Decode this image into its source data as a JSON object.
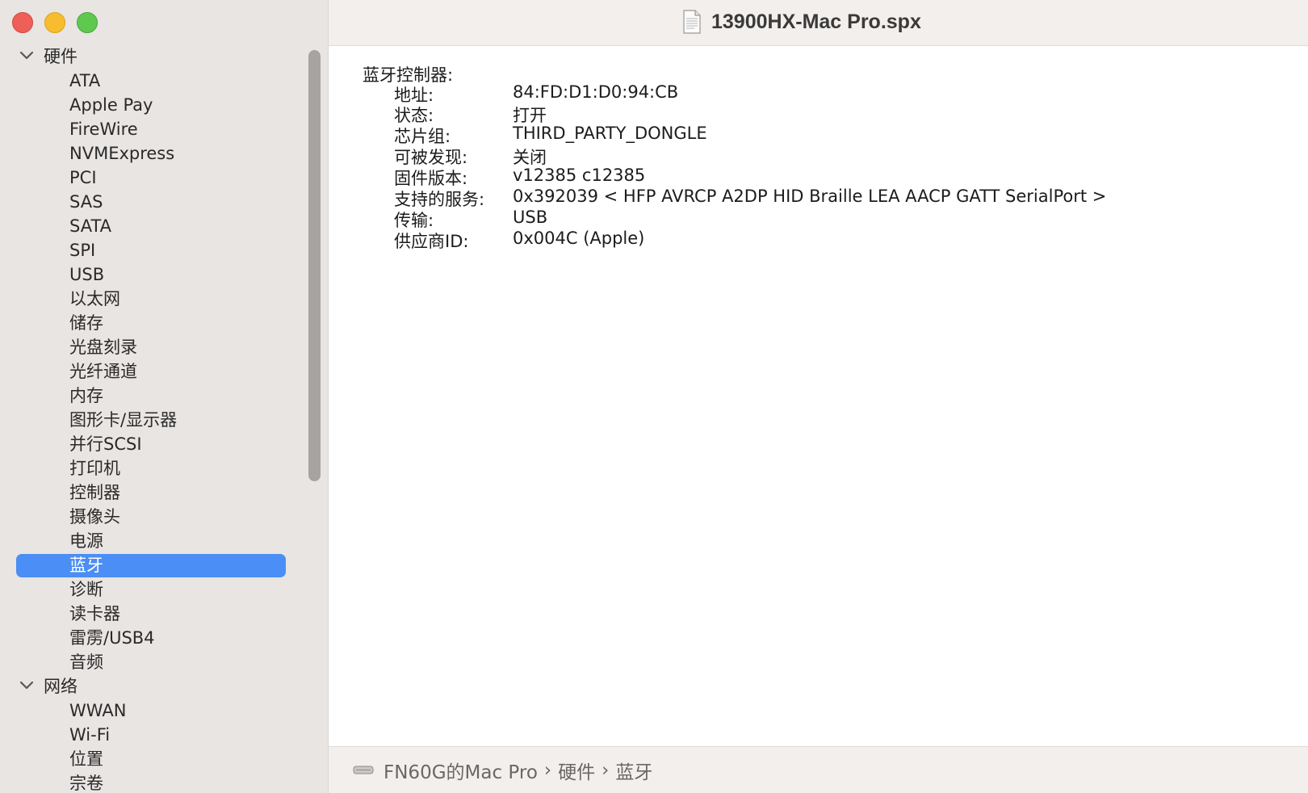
{
  "window": {
    "title": "13900HX-Mac Pro.spx",
    "title_icon": "document-icon"
  },
  "sidebar": {
    "groups": [
      {
        "label": "硬件",
        "expanded": true,
        "items": [
          "ATA",
          "Apple Pay",
          "FireWire",
          "NVMExpress",
          "PCI",
          "SAS",
          "SATA",
          "SPI",
          "USB",
          "以太网",
          "储存",
          "光盘刻录",
          "光纤通道",
          "内存",
          "图形卡/显示器",
          "并行SCSI",
          "打印机",
          "控制器",
          "摄像头",
          "电源",
          "蓝牙",
          "诊断",
          "读卡器",
          "雷雳/USB4",
          "音频"
        ]
      },
      {
        "label": "网络",
        "expanded": true,
        "items": [
          "WWAN",
          "Wi-Fi",
          "位置",
          "宗卷"
        ]
      }
    ],
    "selected": "蓝牙",
    "selection_color": "#4b8ef5"
  },
  "content": {
    "section_title": "蓝牙控制器:",
    "properties": [
      {
        "label": "地址:",
        "value": "84:FD:D1:D0:94:CB"
      },
      {
        "label": "状态:",
        "value": "打开"
      },
      {
        "label": "芯片组:",
        "value": "THIRD_PARTY_DONGLE"
      },
      {
        "label": "可被发现:",
        "value": "关闭"
      },
      {
        "label": "固件版本:",
        "value": "v12385 c12385"
      },
      {
        "label": "支持的服务:",
        "value": "0x392039 < HFP AVRCP A2DP HID Braille LEA AACP GATT SerialPort >"
      },
      {
        "label": "传输:",
        "value": "USB"
      },
      {
        "label": "供应商ID:",
        "value": "0x004C (Apple)"
      }
    ]
  },
  "pathbar": {
    "icon": "mac-pro-icon",
    "crumbs": [
      "FN60G的Mac Pro",
      "硬件",
      "蓝牙"
    ],
    "separator": "›"
  }
}
